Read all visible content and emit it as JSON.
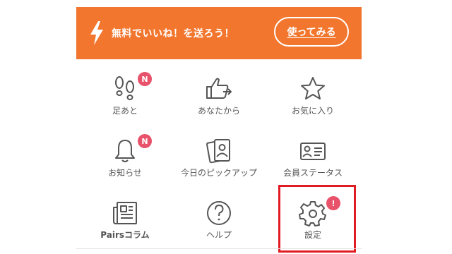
{
  "promo": {
    "message": "無料でいいね！を送ろう！",
    "button_label": "使ってみる",
    "bolt_icon": "lightning-icon",
    "color": "#f2762e"
  },
  "menu": {
    "items": [
      {
        "label": "足あと",
        "icon": "footprints-icon",
        "badge": "N"
      },
      {
        "label": "あなたから",
        "icon": "thumbs-up-icon",
        "badge": ""
      },
      {
        "label": "お気に入り",
        "icon": "star-icon",
        "badge": ""
      },
      {
        "label": "お知らせ",
        "icon": "bell-icon",
        "badge": "N"
      },
      {
        "label": "今日のピックアップ",
        "icon": "cards-icon",
        "badge": ""
      },
      {
        "label": "会員ステータス",
        "icon": "id-card-icon",
        "badge": ""
      },
      {
        "label": "Pairsコラム",
        "icon": "newspaper-icon",
        "badge": ""
      },
      {
        "label": "ヘルプ",
        "icon": "help-icon",
        "badge": ""
      },
      {
        "label": "設定",
        "icon": "gear-icon",
        "badge": "!"
      }
    ]
  },
  "colors": {
    "badge": "#e8526a",
    "highlight": "#e21b22",
    "icon_stroke": "#555555"
  }
}
